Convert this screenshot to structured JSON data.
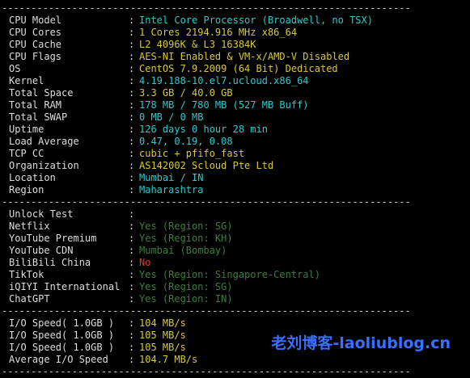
{
  "colors": {
    "cyan": "#30c8c8",
    "yellow": "#d6c93a",
    "green": "#3fb93f",
    "dimgreen": "#3b7e3b",
    "dimcyan": "#2a7d7d",
    "red": "#e03a3a"
  },
  "divider": "----------------------------------------------------------------------",
  "system_info": [
    {
      "label": "CPU Model",
      "value": "Intel Core Processor (Broadwell, no TSX)",
      "color": "cyan"
    },
    {
      "label": "CPU Cores",
      "value": "1 Cores 2194.916 MHz x86_64",
      "color": "yellow"
    },
    {
      "label": "CPU Cache",
      "value": "L2 4096K & L3 16384K",
      "color": "yellow"
    },
    {
      "label": "CPU Flags",
      "value": "AES-NI Enabled & VM-x/AMD-V Disabled",
      "color": "yellow"
    },
    {
      "label": "OS",
      "value": "CentOS 7.9.2009 (64 Bit) Dedicated",
      "color": "yellow"
    },
    {
      "label": "Kernel",
      "value": "4.19.188-10.el7.ucloud.x86_64",
      "color": "cyan"
    },
    {
      "label": "Total Space",
      "value": "3.3 GB / 40.0 GB",
      "color": "yellow"
    },
    {
      "label": "Total RAM",
      "value": "178 MB / 780 MB (527 MB Buff)",
      "color": "cyan"
    },
    {
      "label": "Total SWAP",
      "value": "0 MB / 0 MB",
      "color": "cyan"
    },
    {
      "label": "Uptime",
      "value": "126 days 0 hour 28 min",
      "color": "cyan"
    },
    {
      "label": "Load Average",
      "value": "0.47, 0.19, 0.08",
      "color": "cyan"
    },
    {
      "label": "TCP CC",
      "value": "cubic + pfifo_fast",
      "color": "yellow"
    },
    {
      "label": "Organization",
      "value": "AS142002 Scloud Pte Ltd",
      "color": "yellow"
    },
    {
      "label": "Location",
      "value": "Mumbai / IN",
      "color": "cyan"
    },
    {
      "label": "Region",
      "value": "Maharashtra",
      "color": "cyan"
    }
  ],
  "unlock_test": [
    {
      "label": "Unlock Test",
      "value": "",
      "color": "cyan"
    },
    {
      "label": "Netflix",
      "value": "Yes (Region: SG)",
      "color": "dimgreen"
    },
    {
      "label": "YouTube Premium",
      "value": "Yes (Region: KH)",
      "color": "dimgreen"
    },
    {
      "label": "YouTube CDN",
      "value": "Mumbai (Bombay)",
      "color": "dimgreen"
    },
    {
      "label": "BiliBili China",
      "value": "No",
      "color": "red"
    },
    {
      "label": "TikTok",
      "value": "Yes (Region: Singapore-Central)",
      "color": "dimgreen"
    },
    {
      "label": "iQIYI International",
      "value": "Yes (Region: SG)",
      "color": "dimgreen"
    },
    {
      "label": "ChatGPT",
      "value": "Yes (Region: IN)",
      "color": "dimgreen"
    }
  ],
  "io_speed": [
    {
      "label": "I/O Speed( 1.0GB )",
      "value": "104 MB/s",
      "color": "yellow"
    },
    {
      "label": "I/O Speed( 1.0GB )",
      "value": "105 MB/s",
      "color": "yellow"
    },
    {
      "label": "I/O Speed( 1.0GB )",
      "value": "105 MB/s",
      "color": "yellow"
    },
    {
      "label": "Average I/O Speed",
      "value": "104.7 MB/s",
      "color": "yellow"
    }
  ],
  "watermark": "老刘博客-laoliublog.cn"
}
